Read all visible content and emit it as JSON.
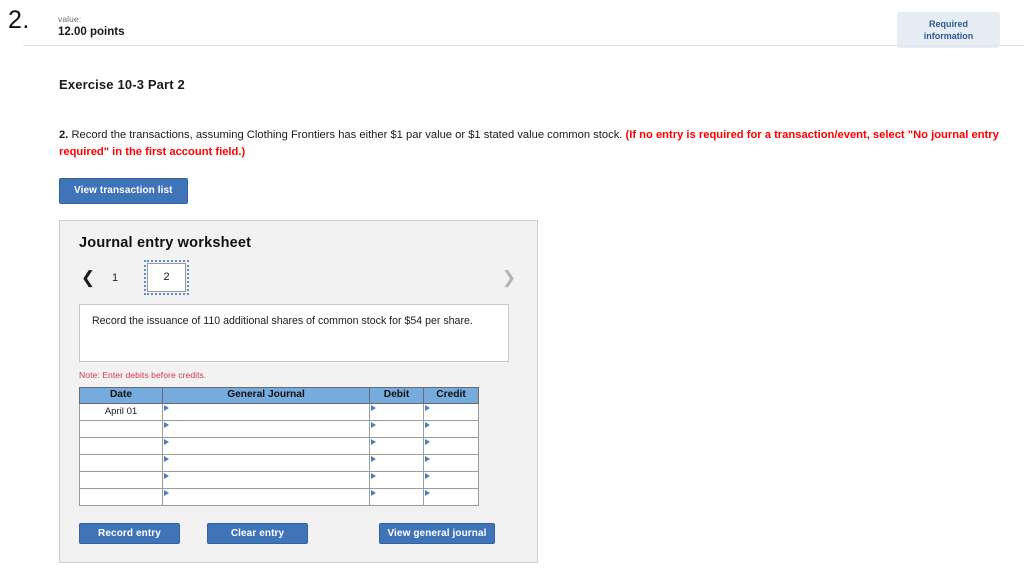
{
  "header": {
    "question_number": "2.",
    "value_label": "value:",
    "points": "12.00 points",
    "required_badge_line1": "Required",
    "required_badge_line2": "information",
    "badge_color": "#e7edf4",
    "badge_text_color": "#2d5a94"
  },
  "exercise": {
    "title": "Exercise 10-3 Part 2"
  },
  "instruction": {
    "number": "2.",
    "text": " Record the transactions, assuming Clothing Frontiers has either $1 par value or $1 stated value common stock. ",
    "alert": "(If no entry is required for a transaction/event, select \"No journal entry required\" in the first account field.)",
    "alert_color": "#ff0000"
  },
  "buttons": {
    "view_transaction_list": "View transaction list",
    "record_entry": "Record entry",
    "clear_entry": "Clear entry",
    "view_general_journal": "View general journal",
    "primary_color": "#4074b8"
  },
  "worksheet": {
    "title": "Journal entry worksheet",
    "pager": {
      "prev_icon": "chevron-left",
      "next_icon": "chevron-right",
      "pages": [
        "1",
        "2"
      ],
      "active_page": "2"
    },
    "transaction_description": "Record the issuance of 110 additional shares of common stock for $54 per share.",
    "note": "Note: Enter debits before credits.",
    "note_color": "#d4394b"
  },
  "journal_table": {
    "header_color": "#76abde",
    "columns": [
      "Date",
      "General Journal",
      "Debit",
      "Credit"
    ],
    "rows": [
      {
        "date": "April 01",
        "general_journal": "",
        "debit": "",
        "credit": ""
      },
      {
        "date": "",
        "general_journal": "",
        "debit": "",
        "credit": ""
      },
      {
        "date": "",
        "general_journal": "",
        "debit": "",
        "credit": ""
      },
      {
        "date": "",
        "general_journal": "",
        "debit": "",
        "credit": ""
      },
      {
        "date": "",
        "general_journal": "",
        "debit": "",
        "credit": ""
      },
      {
        "date": "",
        "general_journal": "",
        "debit": "",
        "credit": ""
      }
    ]
  }
}
